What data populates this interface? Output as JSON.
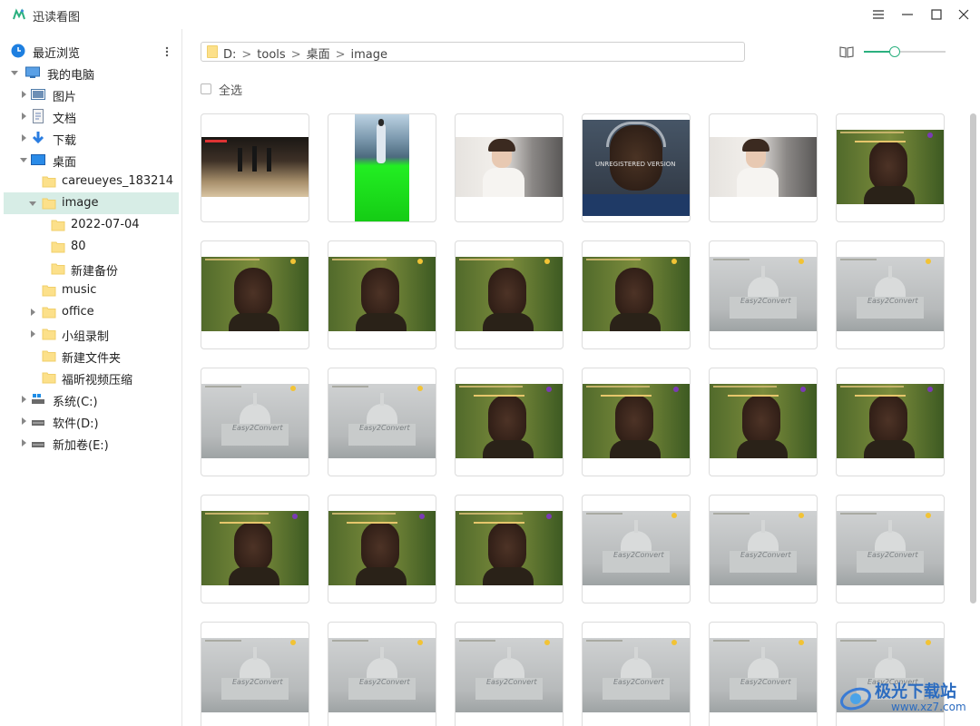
{
  "app": {
    "title": "迅读看图"
  },
  "sidebar": {
    "recent": "最近浏览",
    "tree": [
      {
        "id": "mycomputer",
        "label": "我的电脑",
        "icon": "computer-icon",
        "level": 0,
        "caret": "down"
      },
      {
        "id": "pictures",
        "label": "图片",
        "icon": "pictures-icon",
        "level": 1,
        "caret": "right"
      },
      {
        "id": "documents",
        "label": "文档",
        "icon": "document-icon",
        "level": 1,
        "caret": "right"
      },
      {
        "id": "downloads",
        "label": "下载",
        "icon": "download-icon",
        "level": 1,
        "caret": "right"
      },
      {
        "id": "desktop",
        "label": "桌面",
        "icon": "desktop-icon",
        "level": 1,
        "caret": "down"
      },
      {
        "id": "careueyes",
        "label": "careueyes_183214",
        "icon": "folder-icon",
        "level": 2,
        "caret": ""
      },
      {
        "id": "image",
        "label": "image",
        "icon": "folder-icon",
        "level": 2,
        "caret": "down",
        "selected": true
      },
      {
        "id": "d20220704",
        "label": "2022-07-04",
        "icon": "folder-icon",
        "level": 3,
        "caret": ""
      },
      {
        "id": "f80",
        "label": "80",
        "icon": "folder-icon",
        "level": 3,
        "caret": ""
      },
      {
        "id": "newbackup",
        "label": "新建备份",
        "icon": "folder-icon",
        "level": 3,
        "caret": ""
      },
      {
        "id": "music",
        "label": "music",
        "icon": "folder-icon",
        "level": 2,
        "caret": ""
      },
      {
        "id": "office",
        "label": "office",
        "icon": "folder-icon",
        "level": 2,
        "caret": "right"
      },
      {
        "id": "grouprec",
        "label": "小组录制",
        "icon": "folder-icon",
        "level": 2,
        "caret": "right"
      },
      {
        "id": "newfolder",
        "label": "新建文件夹",
        "icon": "folder-icon",
        "level": 2,
        "caret": ""
      },
      {
        "id": "fuxin",
        "label": "福昕视频压缩",
        "icon": "folder-icon",
        "level": 2,
        "caret": ""
      },
      {
        "id": "driveC",
        "label": "系统(C:)",
        "icon": "system-drive-icon",
        "level": 1,
        "caret": "right"
      },
      {
        "id": "driveD",
        "label": "软件(D:)",
        "icon": "drive-icon",
        "level": 1,
        "caret": "right"
      },
      {
        "id": "driveE",
        "label": "新加卷(E:)",
        "icon": "drive-icon",
        "level": 1,
        "caret": "right"
      }
    ]
  },
  "path": {
    "segments": [
      "D:",
      "tools",
      "桌面",
      "image"
    ],
    "separator": ">"
  },
  "toolbar": {
    "zoom_level": 0.38
  },
  "select_all": "全选",
  "thumbnails": [
    "dance",
    "girl-lake",
    "portrait-woman",
    "unregistered",
    "portrait-woman",
    "man-caption",
    "man",
    "man",
    "man",
    "man",
    "capitol",
    "capitol",
    "capitol",
    "capitol",
    "man-caption",
    "man-caption",
    "man-caption",
    "man-caption",
    "man-caption",
    "man-caption",
    "man-caption",
    "capitol",
    "capitol",
    "capitol",
    "capitol",
    "capitol",
    "capitol",
    "capitol",
    "capitol",
    "capitol"
  ],
  "thumbnail_text": {
    "unregistered": "UNREGISTERED VERSION",
    "easy2convert": "Easy2Convert"
  },
  "watermark": {
    "text": "极光下载站",
    "sub": "www.xz7.com"
  },
  "colors": {
    "accent": "#2bb07f",
    "selected_row": "#d7ede6",
    "folder": "#fce08a"
  }
}
